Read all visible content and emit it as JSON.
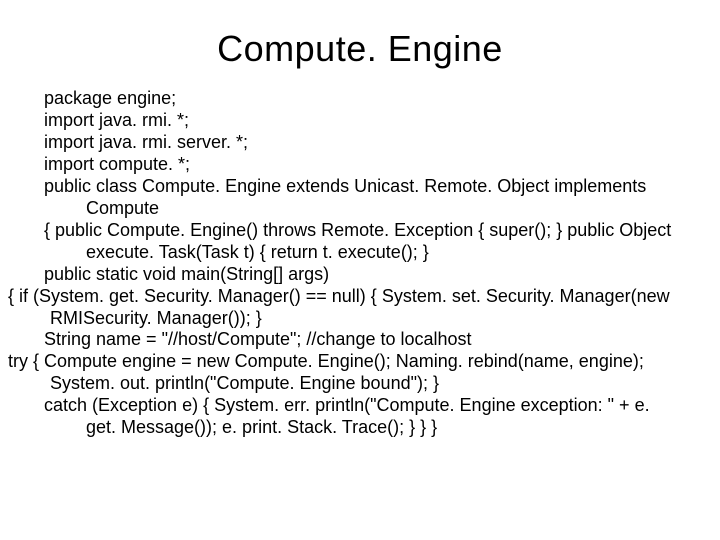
{
  "title": "Compute. Engine",
  "lines": [
    "package engine;",
    "import java. rmi. *;",
    "import java. rmi. server. *;",
    "import compute. *;",
    "public class Compute. Engine extends Unicast. Remote. Object implements Compute",
    "{ public Compute. Engine() throws Remote. Exception { super(); } public Object execute. Task(Task t) { return t. execute(); }",
    "public static void main(String[] args)",
    " { if (System. get. Security. Manager() == null) { System. set. Security. Manager(new RMISecurity. Manager()); }",
    "String name = \"//host/Compute\"; //change to localhost",
    " try { Compute engine = new Compute. Engine(); Naming. rebind(name, engine); System. out. println(\"Compute. Engine bound\"); }",
    "catch (Exception e) { System. err. println(\"Compute. Engine exception: \" + e. get. Message()); e. print. Stack. Trace(); } } }"
  ]
}
